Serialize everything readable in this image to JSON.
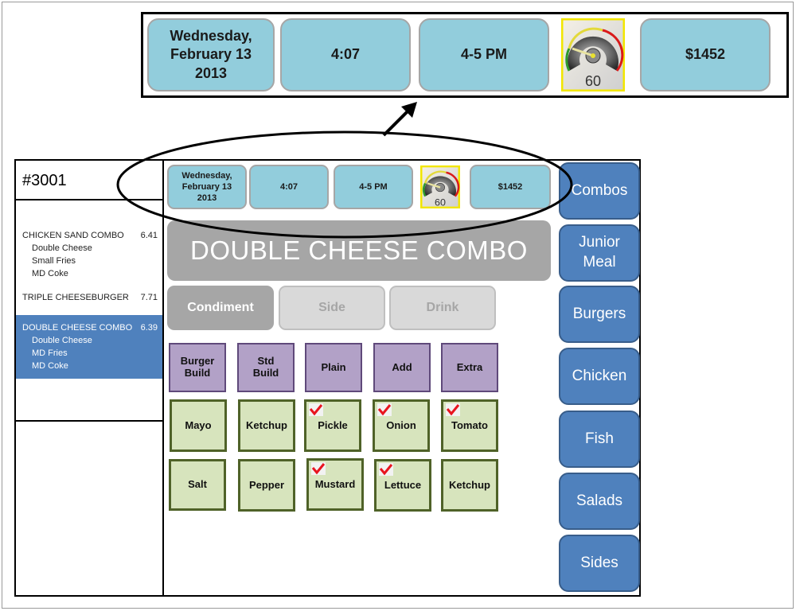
{
  "callout": {
    "date_line1": "Wednesday,",
    "date_line2": "February 13",
    "date_line3": "2013",
    "time": "4:07",
    "hour_range": "4-5 PM",
    "speed_gauge_value": "60",
    "sales": "$1452"
  },
  "order": {
    "number": "#3001",
    "items": [
      {
        "name": "CHICKEN SAND COMBO",
        "price": "6.41",
        "components": [
          "Double Cheese",
          "Small Fries",
          "MD Coke"
        ],
        "selected": false
      },
      {
        "name": "TRIPLE CHEESEBURGER",
        "price": "7.71",
        "components": [],
        "selected": false
      },
      {
        "name": "DOUBLE CHEESE COMBO",
        "price": "6.39",
        "components": [
          "Double Cheese",
          "MD Fries",
          "MD Coke"
        ],
        "selected": true
      }
    ]
  },
  "status_strip": {
    "date_line1": "Wednesday,",
    "date_line2": "February 13",
    "date_line3": "2013",
    "time": "4:07",
    "hour_range": "4-5 PM",
    "speed_gauge_value": "60",
    "sales": "$1452"
  },
  "current_item": {
    "title": "DOUBLE CHEESE COMBO"
  },
  "component_tabs": [
    {
      "label": "Condiment",
      "active": true
    },
    {
      "label": "Side",
      "active": false
    },
    {
      "label": "Drink",
      "active": false
    }
  ],
  "build_options": [
    {
      "label_line1": "Burger",
      "label_line2": "Build"
    },
    {
      "label_line1": "Std",
      "label_line2": "Build"
    },
    {
      "label_line1": "Plain",
      "label_line2": ""
    },
    {
      "label_line1": "Add",
      "label_line2": ""
    },
    {
      "label_line1": "Extra",
      "label_line2": ""
    }
  ],
  "condiments": [
    {
      "label": "Mayo",
      "checked": false
    },
    {
      "label": "Ketchup",
      "checked": false
    },
    {
      "label": "Pickle",
      "checked": true
    },
    {
      "label": "Onion",
      "checked": true
    },
    {
      "label": "Tomato",
      "checked": true
    },
    {
      "label": "Salt",
      "checked": false
    },
    {
      "label": "Pepper",
      "checked": false
    },
    {
      "label": "Mustard",
      "checked": true
    },
    {
      "label": "Lettuce",
      "checked": true
    },
    {
      "label": "Ketchup",
      "checked": false
    }
  ],
  "menu_categories": [
    {
      "label_line1": "Combos",
      "label_line2": ""
    },
    {
      "label_line1": "Junior",
      "label_line2": "Meal"
    },
    {
      "label_line1": "Burgers",
      "label_line2": ""
    },
    {
      "label_line1": "Chicken",
      "label_line2": ""
    },
    {
      "label_line1": "Fish",
      "label_line2": ""
    },
    {
      "label_line1": "Salads",
      "label_line2": ""
    },
    {
      "label_line1": "Sides",
      "label_line2": ""
    }
  ],
  "colors": {
    "status_tile": "#92cddc",
    "menu_button": "#4f81bd",
    "selected_order_item": "#4f81bd",
    "build_option": "#b2a1c7",
    "condiment": "#d7e4bd",
    "check_mark": "#e8141e",
    "title_bar": "#a6a6a6"
  }
}
